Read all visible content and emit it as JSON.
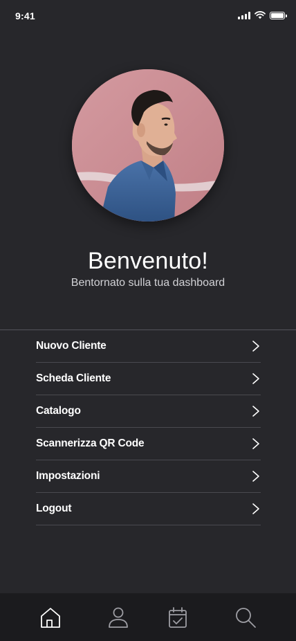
{
  "status_bar": {
    "time": "9:41",
    "icons": [
      "signal-icon",
      "wifi-icon",
      "battery-icon"
    ]
  },
  "profile": {
    "avatar_icon": "profile-photo",
    "greeting_title": "Benvenuto!",
    "greeting_subtitle": "Bentornato sulla tua dashboard"
  },
  "menu": {
    "items": [
      {
        "label": "Nuovo Cliente",
        "icon": "chevron-right-icon"
      },
      {
        "label": "Scheda Cliente",
        "icon": "chevron-right-icon"
      },
      {
        "label": "Catalogo",
        "icon": "chevron-right-icon"
      },
      {
        "label": "Scannerizza QR Code",
        "icon": "chevron-right-icon"
      },
      {
        "label": "Impostazioni",
        "icon": "chevron-right-icon"
      },
      {
        "label": "Logout",
        "icon": "chevron-right-icon"
      }
    ]
  },
  "tab_bar": {
    "tabs": [
      {
        "icon": "home-icon",
        "active": true
      },
      {
        "icon": "user-icon",
        "active": false
      },
      {
        "icon": "calendar-check-icon",
        "active": false
      },
      {
        "icon": "search-icon",
        "active": false
      }
    ]
  },
  "colors": {
    "background": "#27272b",
    "tab_bar": "#1b1b1e",
    "divider": "#4a4a50",
    "text": "#ffffff",
    "subtitle": "#d2d2d6",
    "avatar_wall": "#c98a90"
  }
}
